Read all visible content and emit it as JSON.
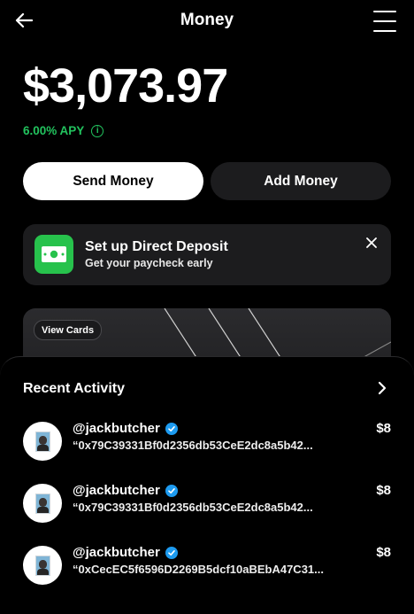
{
  "header": {
    "title": "Money"
  },
  "balance": {
    "amount": "$3,073.97",
    "apy": "6.00% APY"
  },
  "actions": {
    "send_label": "Send Money",
    "add_label": "Add Money"
  },
  "direct_deposit": {
    "title": "Set up Direct Deposit",
    "subtitle": "Get your paycheck early"
  },
  "cards": {
    "view_cards_label": "View Cards"
  },
  "recent_activity": {
    "title": "Recent Activity",
    "items": [
      {
        "handle": "@jackbutcher",
        "note": "“0x79C39331Bf0d2356db53CeE2dc8a5b42...",
        "amount": "$8"
      },
      {
        "handle": "@jackbutcher",
        "note": "“0x79C39331Bf0d2356db53CeE2dc8a5b42...",
        "amount": "$8"
      },
      {
        "handle": "@jackbutcher",
        "note": "“0xCecEC5f6596D2269B5dcf10aBEbA47C31...",
        "amount": "$8"
      }
    ]
  },
  "icons": {
    "back": "arrow-left-icon",
    "menu": "hamburger-menu-icon",
    "info": "info-icon",
    "cash": "cash-bill-icon",
    "close": "close-icon",
    "chevron": "chevron-right-icon",
    "verified": "verified-badge-icon"
  },
  "colors": {
    "background": "#000000",
    "accent_green": "#22c35e",
    "surface": "#1c1c1e",
    "verified_blue": "#1d9bf0"
  }
}
